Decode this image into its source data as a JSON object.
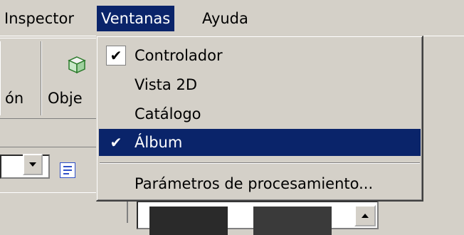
{
  "menubar": {
    "items": [
      {
        "label": "Inspector",
        "open": false
      },
      {
        "label": "Ventanas",
        "open": true
      },
      {
        "label": "Ayuda",
        "open": false
      }
    ]
  },
  "toolbar": {
    "button1_label": "ón",
    "button2_label": "Obje"
  },
  "menu": {
    "items": [
      {
        "label": "Controlador",
        "checked": true,
        "highlighted": false
      },
      {
        "label": "Vista 2D",
        "checked": false,
        "highlighted": false
      },
      {
        "label": "Catálogo",
        "checked": false,
        "highlighted": false
      },
      {
        "label": "Álbum",
        "checked": true,
        "highlighted": true
      }
    ],
    "after_separator": {
      "label": "Parámetros de procesamiento..."
    }
  },
  "colors": {
    "menu_highlight": "#0a246a",
    "face": "#d4d0c8"
  },
  "icons": {
    "check": "checkmark-icon",
    "object": "cube-icon",
    "list": "list-view-icon"
  }
}
